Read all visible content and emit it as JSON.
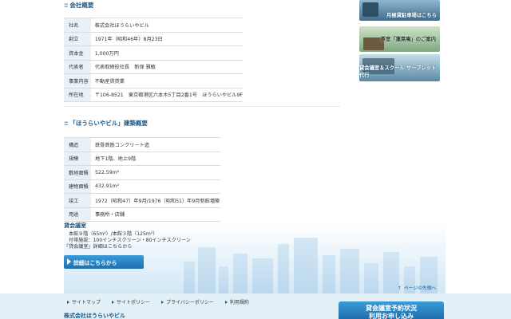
{
  "company": {
    "title": "会社概要",
    "rows": [
      {
        "label": "社名",
        "value": "株式会社ほうらいやビル"
      },
      {
        "label": "創立",
        "value": "1971年（昭和46年）8月23日"
      },
      {
        "label": "資本金",
        "value": "1,000万円"
      },
      {
        "label": "代表者",
        "value": "代表取締役社長　新保 雅敏"
      },
      {
        "label": "事業内容",
        "value": "不動産賃貸業"
      },
      {
        "label": "所在地",
        "value": "〒106-8521　東京都港区六本木5丁目2番1号　ほうらいやビル9F"
      }
    ]
  },
  "building": {
    "title": "「ほうらいやビル」建築概要",
    "rows": [
      {
        "label": "構造",
        "value": "鉄骨鉄筋コンクリート造"
      },
      {
        "label": "規模",
        "value": "地下1階、地上9階"
      },
      {
        "label": "敷地面積",
        "value": "522.59m²"
      },
      {
        "label": "建物面積",
        "value": "432.91m²"
      },
      {
        "label": "竣工",
        "value": "1972（昭和47）年9月/1976（昭和51）年9月新館増築"
      },
      {
        "label": "用途",
        "value": "事務所・店舗"
      }
    ]
  },
  "meeting": {
    "title": "貸会議室",
    "line1": "本館９階（65m²）/本館３階（125m²）",
    "line2": "付帯施設：100インチスクリーン・80インチスクリーン",
    "line3": "『貸会議室』詳細はこちらから",
    "button": "詳細はこちらから"
  },
  "page_top": "ページの先頭へ",
  "sidebar": {
    "banner1": "月極貸駐車場はこちら",
    "banner2": "茶室「蓬萊庵」のご案内",
    "banner3": "貸会議室＆スクール サーブレット代行"
  },
  "footer": {
    "links": [
      "サイトマップ",
      "サイトポリシー",
      "プライバシーポリシー",
      "利用規約"
    ],
    "company": "株式会社ほうらいやビル",
    "reserve": "貸会議室予約状況",
    "reserve2": "利用お申し込み"
  }
}
